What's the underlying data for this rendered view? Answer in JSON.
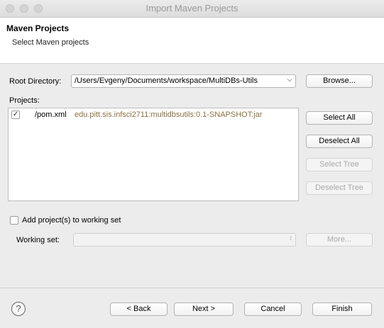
{
  "window": {
    "title": "Import Maven Projects"
  },
  "header": {
    "title": "Maven Projects",
    "subtitle": "Select Maven projects"
  },
  "root_directory": {
    "label": "Root Directory:",
    "value": "/Users/Evgeny/Documents/workspace/MultiDBs-Utils",
    "browse_label": "Browse..."
  },
  "projects": {
    "label": "Projects:",
    "items": [
      {
        "checked": true,
        "name": "/pom.xml",
        "id": "edu.pitt.sis.infsci2711:multidbsutils:0.1-SNAPSHOT:jar"
      }
    ],
    "select_all": "Select All",
    "deselect_all": "Deselect All",
    "select_tree": "Select Tree",
    "deselect_tree": "Deselect Tree"
  },
  "working_set": {
    "checkbox_label": "Add project(s) to working set",
    "checked": false,
    "label": "Working set:",
    "value": "",
    "more_label": "More..."
  },
  "footer": {
    "help_icon": "?",
    "back_label": "< Back",
    "next_label": "Next >",
    "cancel_label": "Cancel",
    "finish_label": "Finish"
  }
}
